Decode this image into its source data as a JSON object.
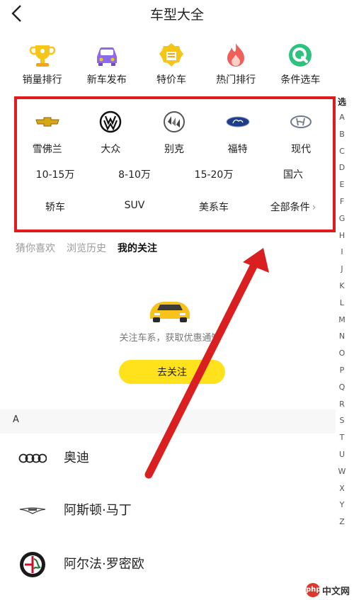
{
  "header": {
    "title": "车型大全"
  },
  "quick_categories": [
    {
      "label": "销量排行",
      "icon": "trophy-icon"
    },
    {
      "label": "新车发布",
      "icon": "new-car-icon"
    },
    {
      "label": "特价车",
      "icon": "discount-icon"
    },
    {
      "label": "热门排行",
      "icon": "flame-icon"
    },
    {
      "label": "条件选车",
      "icon": "search-q-icon"
    }
  ],
  "filter": {
    "brands": [
      {
        "name": "雪佛兰",
        "icon": "chevrolet-logo-icon"
      },
      {
        "name": "大众",
        "icon": "volkswagen-logo-icon"
      },
      {
        "name": "别克",
        "icon": "buick-logo-icon"
      },
      {
        "name": "福特",
        "icon": "ford-logo-icon"
      },
      {
        "name": "现代",
        "icon": "hyundai-logo-icon"
      }
    ],
    "prices": [
      "10-15万",
      "8-10万",
      "15-20万",
      "国六"
    ],
    "types": [
      "轿车",
      "SUV",
      "美系车",
      "全部条件"
    ]
  },
  "alphabet": {
    "title": "选",
    "letters": [
      "A",
      "B",
      "C",
      "D",
      "E",
      "F",
      "G",
      "H",
      "I",
      "J",
      "K",
      "L",
      "M",
      "N",
      "O",
      "P",
      "Q",
      "R",
      "S",
      "T",
      "U",
      "W",
      "X",
      "Y",
      "Z"
    ]
  },
  "tabs": [
    {
      "label": "猜你喜欢",
      "active": false
    },
    {
      "label": "浏览历史",
      "active": false
    },
    {
      "label": "我的关注",
      "active": true
    }
  ],
  "empty_state": {
    "text": "关注车系，获取优惠通知",
    "button": "去关注"
  },
  "brand_list": {
    "section": "A",
    "items": [
      {
        "name": "奥迪",
        "icon": "audi-logo-icon"
      },
      {
        "name": "阿斯顿·马丁",
        "icon": "aston-martin-logo-icon"
      },
      {
        "name": "阿尔法·罗密欧",
        "icon": "alfa-romeo-logo-icon"
      }
    ]
  },
  "colors": {
    "accent": "#ffe11c",
    "highlight": "#e01b1b"
  },
  "watermark": {
    "badge": "php",
    "text": "中文网"
  }
}
